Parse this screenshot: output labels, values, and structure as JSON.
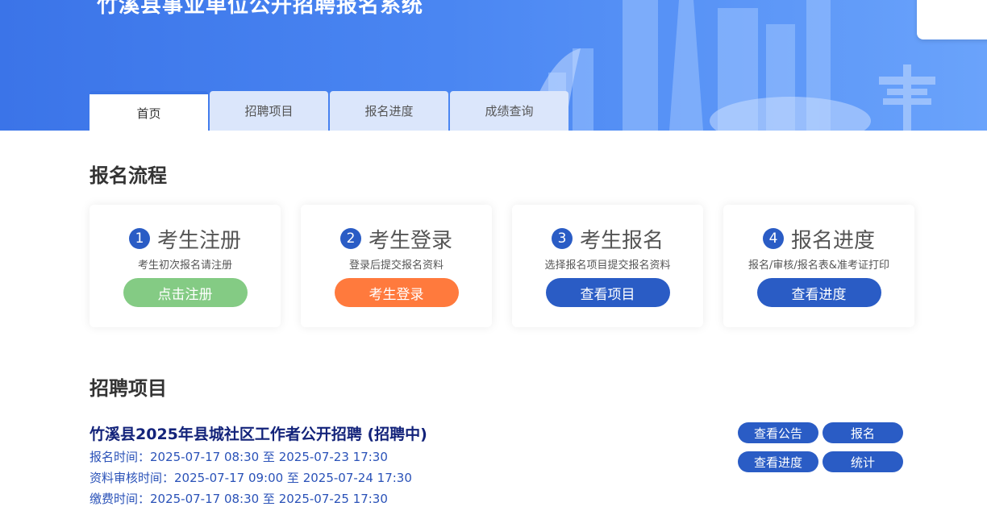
{
  "header": {
    "site_title": "竹溪县事业单位公开招聘报名系统"
  },
  "tabs": [
    {
      "label": "首页",
      "active": true
    },
    {
      "label": "招聘项目",
      "active": false
    },
    {
      "label": "报名进度",
      "active": false
    },
    {
      "label": "成绩查询",
      "active": false
    }
  ],
  "flow": {
    "title": "报名流程",
    "steps": [
      {
        "num": "1",
        "title": "考生注册",
        "desc": "考生初次报名请注册",
        "button": "点击注册"
      },
      {
        "num": "2",
        "title": "考生登录",
        "desc": "登录后提交报名资料",
        "button": "考生登录"
      },
      {
        "num": "3",
        "title": "考生报名",
        "desc": "选择报名项目提交报名资料",
        "button": "查看项目"
      },
      {
        "num": "4",
        "title": "报名进度",
        "desc": "报名/审核/报名表&准考证打印",
        "button": "查看进度"
      }
    ]
  },
  "projects": {
    "title": "招聘项目",
    "items": [
      {
        "title": "竹溪县2025年县城社区工作者公开招聘 (招聘中)",
        "lines": [
          "报名时间：2025-07-17 08:30 至 2025-07-23 17:30",
          "资料审核时间：2025-07-17 09:00 至 2025-07-24 17:30",
          "缴费时间：2025-07-17 08:30 至 2025-07-25 17:30"
        ],
        "actions": [
          "查看公告",
          "报名",
          "查看进度",
          "统计"
        ]
      }
    ]
  },
  "colors": {
    "primary": "#2a5cc5",
    "green": "#84cb84",
    "orange": "#ff7a3d",
    "banner": "#3b74e8"
  }
}
